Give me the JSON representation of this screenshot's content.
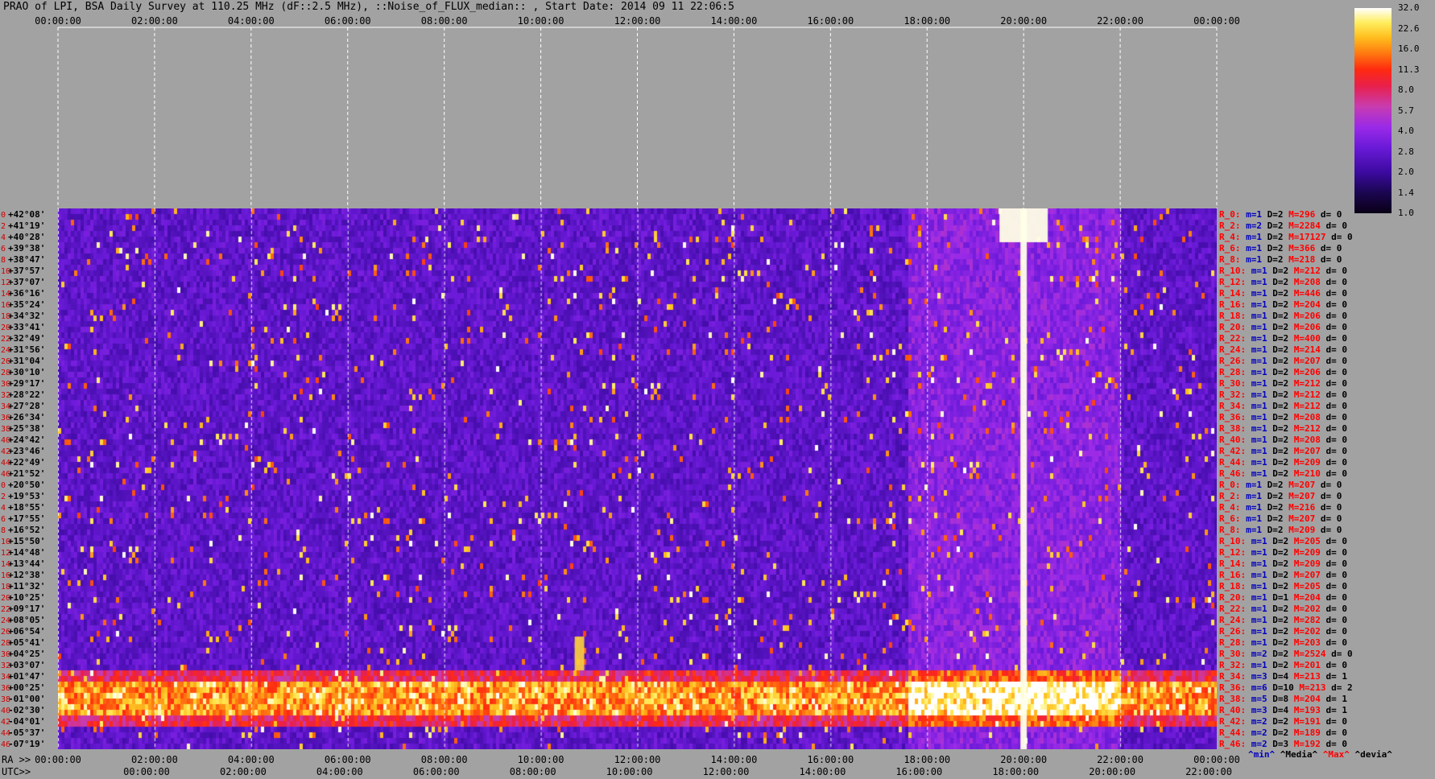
{
  "title": "PRAO of LPI, BSA Daily Survey at 110.25 MHz (dF::2.5 MHz), ::Noise_of_FLUX_median:: , Start Date: 2014 09 11 22:06:5",
  "chart_data": {
    "type": "heatmap",
    "title": "PRAO of LPI, BSA Daily Survey at 110.25 MHz (dF::2.5 MHz), ::Noise_of_FLUX_median:: , Start Date: 2014 09 11 22:06:5",
    "x_top_ticks": [
      "00:00:00",
      "02:00:00",
      "04:00:00",
      "06:00:00",
      "08:00:00",
      "10:00:00",
      "12:00:00",
      "14:00:00",
      "16:00:00",
      "18:00:00",
      "20:00:00",
      "22:00:00",
      "00:00:00"
    ],
    "x_bottom_ra_label": "RA >>",
    "x_bottom_ra_ticks": [
      "00:00:00",
      "02:00:00",
      "04:00:00",
      "06:00:00",
      "08:00:00",
      "10:00:00",
      "12:00:00",
      "14:00:00",
      "16:00:00",
      "18:00:00",
      "20:00:00",
      "22:00:00",
      "00:00:00"
    ],
    "x_bottom_utc_label": "UTC>>",
    "x_bottom_utc_ticks": [
      "00:00:00",
      "02:00:00",
      "04:00:00",
      "06:00:00",
      "08:00:00",
      "10:00:00",
      "12:00:00",
      "14:00:00",
      "16:00:00",
      "18:00:00",
      "20:00:00",
      "22:00:00"
    ],
    "y_dec_labels": [
      "+42°08'",
      "+41°19'",
      "+40°28'",
      "+39°38'",
      "+38°47'",
      "+37°57'",
      "+37°07'",
      "+36°16'",
      "+35°24'",
      "+34°32'",
      "+33°41'",
      "+32°49'",
      "+31°56'",
      "+31°04'",
      "+30°10'",
      "+29°17'",
      "+28°22'",
      "+27°28'",
      "+26°34'",
      "+25°38'",
      "+24°42'",
      "+23°46'",
      "+22°49'",
      "+21°52'",
      "+20°50'",
      "+19°53'",
      "+18°55'",
      "+17°55'",
      "+16°52'",
      "+15°50'",
      "+14°48'",
      "+13°44'",
      "+12°38'",
      "+11°32'",
      "+10°25'",
      "+09°17'",
      "+08°05'",
      "+06°54'",
      "+05°41'",
      "+04°25'",
      "+03°07'",
      "+01°47'",
      "+00°25'",
      "-01°00'",
      "-02°30'",
      "-04°01'",
      "-05°37'",
      "-07°19'"
    ],
    "y_index_labels": [
      "0",
      "2",
      "4",
      "6",
      "8",
      "10",
      "12",
      "14",
      "16",
      "18",
      "20",
      "22",
      "24",
      "26",
      "28",
      "30",
      "32",
      "34",
      "36",
      "38",
      "40",
      "42",
      "44",
      "46",
      "0",
      "2",
      "4",
      "6",
      "8",
      "10",
      "12",
      "14",
      "16",
      "18",
      "20",
      "22",
      "24",
      "26",
      "28",
      "30",
      "32",
      "34",
      "36",
      "38",
      "40",
      "42",
      "44",
      "46"
    ],
    "row_stats": [
      {
        "r": "R_0:",
        "m": "m=1",
        "D": "D=2",
        "M": "M=296",
        "d": "d= 0"
      },
      {
        "r": "R_2:",
        "m": "m=2",
        "D": "D=2",
        "M": "M=2284",
        "d": "d= 0"
      },
      {
        "r": "R_4:",
        "m": "m=1",
        "D": "D=2",
        "M": "M=17127",
        "d": "d= 0"
      },
      {
        "r": "R_6:",
        "m": "m=1",
        "D": "D=2",
        "M": "M=366",
        "d": "d= 0"
      },
      {
        "r": "R_8:",
        "m": "m=1",
        "D": "D=2",
        "M": "M=218",
        "d": "d= 0"
      },
      {
        "r": "R_10:",
        "m": "m=1",
        "D": "D=2",
        "M": "M=212",
        "d": "d= 0"
      },
      {
        "r": "R_12:",
        "m": "m=1",
        "D": "D=2",
        "M": "M=208",
        "d": "d= 0"
      },
      {
        "r": "R_14:",
        "m": "m=1",
        "D": "D=2",
        "M": "M=446",
        "d": "d= 0"
      },
      {
        "r": "R_16:",
        "m": "m=1",
        "D": "D=2",
        "M": "M=204",
        "d": "d= 0"
      },
      {
        "r": "R_18:",
        "m": "m=1",
        "D": "D=2",
        "M": "M=206",
        "d": "d= 0"
      },
      {
        "r": "R_20:",
        "m": "m=1",
        "D": "D=2",
        "M": "M=206",
        "d": "d= 0"
      },
      {
        "r": "R_22:",
        "m": "m=1",
        "D": "D=2",
        "M": "M=400",
        "d": "d= 0"
      },
      {
        "r": "R_24:",
        "m": "m=1",
        "D": "D=2",
        "M": "M=214",
        "d": "d= 0"
      },
      {
        "r": "R_26:",
        "m": "m=1",
        "D": "D=2",
        "M": "M=207",
        "d": "d= 0"
      },
      {
        "r": "R_28:",
        "m": "m=1",
        "D": "D=2",
        "M": "M=206",
        "d": "d= 0"
      },
      {
        "r": "R_30:",
        "m": "m=1",
        "D": "D=2",
        "M": "M=212",
        "d": "d= 0"
      },
      {
        "r": "R_32:",
        "m": "m=1",
        "D": "D=2",
        "M": "M=212",
        "d": "d= 0"
      },
      {
        "r": "R_34:",
        "m": "m=1",
        "D": "D=2",
        "M": "M=212",
        "d": "d= 0"
      },
      {
        "r": "R_36:",
        "m": "m=1",
        "D": "D=2",
        "M": "M=208",
        "d": "d= 0"
      },
      {
        "r": "R_38:",
        "m": "m=1",
        "D": "D=2",
        "M": "M=212",
        "d": "d= 0"
      },
      {
        "r": "R_40:",
        "m": "m=1",
        "D": "D=2",
        "M": "M=208",
        "d": "d= 0"
      },
      {
        "r": "R_42:",
        "m": "m=1",
        "D": "D=2",
        "M": "M=207",
        "d": "d= 0"
      },
      {
        "r": "R_44:",
        "m": "m=1",
        "D": "D=2",
        "M": "M=209",
        "d": "d= 0"
      },
      {
        "r": "R_46:",
        "m": "m=1",
        "D": "D=2",
        "M": "M=210",
        "d": "d= 0"
      },
      {
        "r": "R_0:",
        "m": "m=1",
        "D": "D=2",
        "M": "M=207",
        "d": "d= 0"
      },
      {
        "r": "R_2:",
        "m": "m=1",
        "D": "D=2",
        "M": "M=207",
        "d": "d= 0"
      },
      {
        "r": "R_4:",
        "m": "m=1",
        "D": "D=2",
        "M": "M=216",
        "d": "d= 0"
      },
      {
        "r": "R_6:",
        "m": "m=1",
        "D": "D=2",
        "M": "M=207",
        "d": "d= 0"
      },
      {
        "r": "R_8:",
        "m": "m=1",
        "D": "D=2",
        "M": "M=209",
        "d": "d= 0"
      },
      {
        "r": "R_10:",
        "m": "m=1",
        "D": "D=2",
        "M": "M=205",
        "d": "d= 0"
      },
      {
        "r": "R_12:",
        "m": "m=1",
        "D": "D=2",
        "M": "M=209",
        "d": "d= 0"
      },
      {
        "r": "R_14:",
        "m": "m=1",
        "D": "D=2",
        "M": "M=209",
        "d": "d= 0"
      },
      {
        "r": "R_16:",
        "m": "m=1",
        "D": "D=2",
        "M": "M=207",
        "d": "d= 0"
      },
      {
        "r": "R_18:",
        "m": "m=1",
        "D": "D=2",
        "M": "M=205",
        "d": "d= 0"
      },
      {
        "r": "R_20:",
        "m": "m=1",
        "D": "D=1",
        "M": "M=204",
        "d": "d= 0"
      },
      {
        "r": "R_22:",
        "m": "m=1",
        "D": "D=2",
        "M": "M=202",
        "d": "d= 0"
      },
      {
        "r": "R_24:",
        "m": "m=1",
        "D": "D=2",
        "M": "M=282",
        "d": "d= 0"
      },
      {
        "r": "R_26:",
        "m": "m=1",
        "D": "D=2",
        "M": "M=202",
        "d": "d= 0"
      },
      {
        "r": "R_28:",
        "m": "m=1",
        "D": "D=2",
        "M": "M=203",
        "d": "d= 0"
      },
      {
        "r": "R_30:",
        "m": "m=2",
        "D": "D=2",
        "M": "M=2524",
        "d": "d= 0"
      },
      {
        "r": "R_32:",
        "m": "m=1",
        "D": "D=2",
        "M": "M=201",
        "d": "d= 0"
      },
      {
        "r": "R_34:",
        "m": "m=3",
        "D": "D=4",
        "M": "M=213",
        "d": "d= 1"
      },
      {
        "r": "R_36:",
        "m": "m=6",
        "D": "D=10",
        "M": "M=213",
        "d": "d= 2"
      },
      {
        "r": "R_38:",
        "m": "m=5",
        "D": "D=8",
        "M": "M=204",
        "d": "d= 1"
      },
      {
        "r": "R_40:",
        "m": "m=3",
        "D": "D=4",
        "M": "M=193",
        "d": "d= 1"
      },
      {
        "r": "R_42:",
        "m": "m=2",
        "D": "D=2",
        "M": "M=191",
        "d": "d= 0"
      },
      {
        "r": "R_44:",
        "m": "m=2",
        "D": "D=2",
        "M": "M=189",
        "d": "d= 0"
      },
      {
        "r": "R_46:",
        "m": "m=2",
        "D": "D=3",
        "M": "M=192",
        "d": "d= 0"
      }
    ],
    "stat_legend": [
      "^min^",
      "^Media^",
      "^Max^",
      "^devia^"
    ],
    "colorbar_ticks": [
      "1.0",
      "1.4",
      "2.0",
      "2.8",
      "4.0",
      "5.7",
      "8.0",
      "11.3",
      "16.0",
      "22.6",
      "32.0"
    ],
    "colors": {
      "min": "#0000c0",
      "median": "#000000",
      "max": "#ff0000",
      "devia": "#000000",
      "rowlabel": "#d00000",
      "grid": "#ffffff"
    }
  }
}
